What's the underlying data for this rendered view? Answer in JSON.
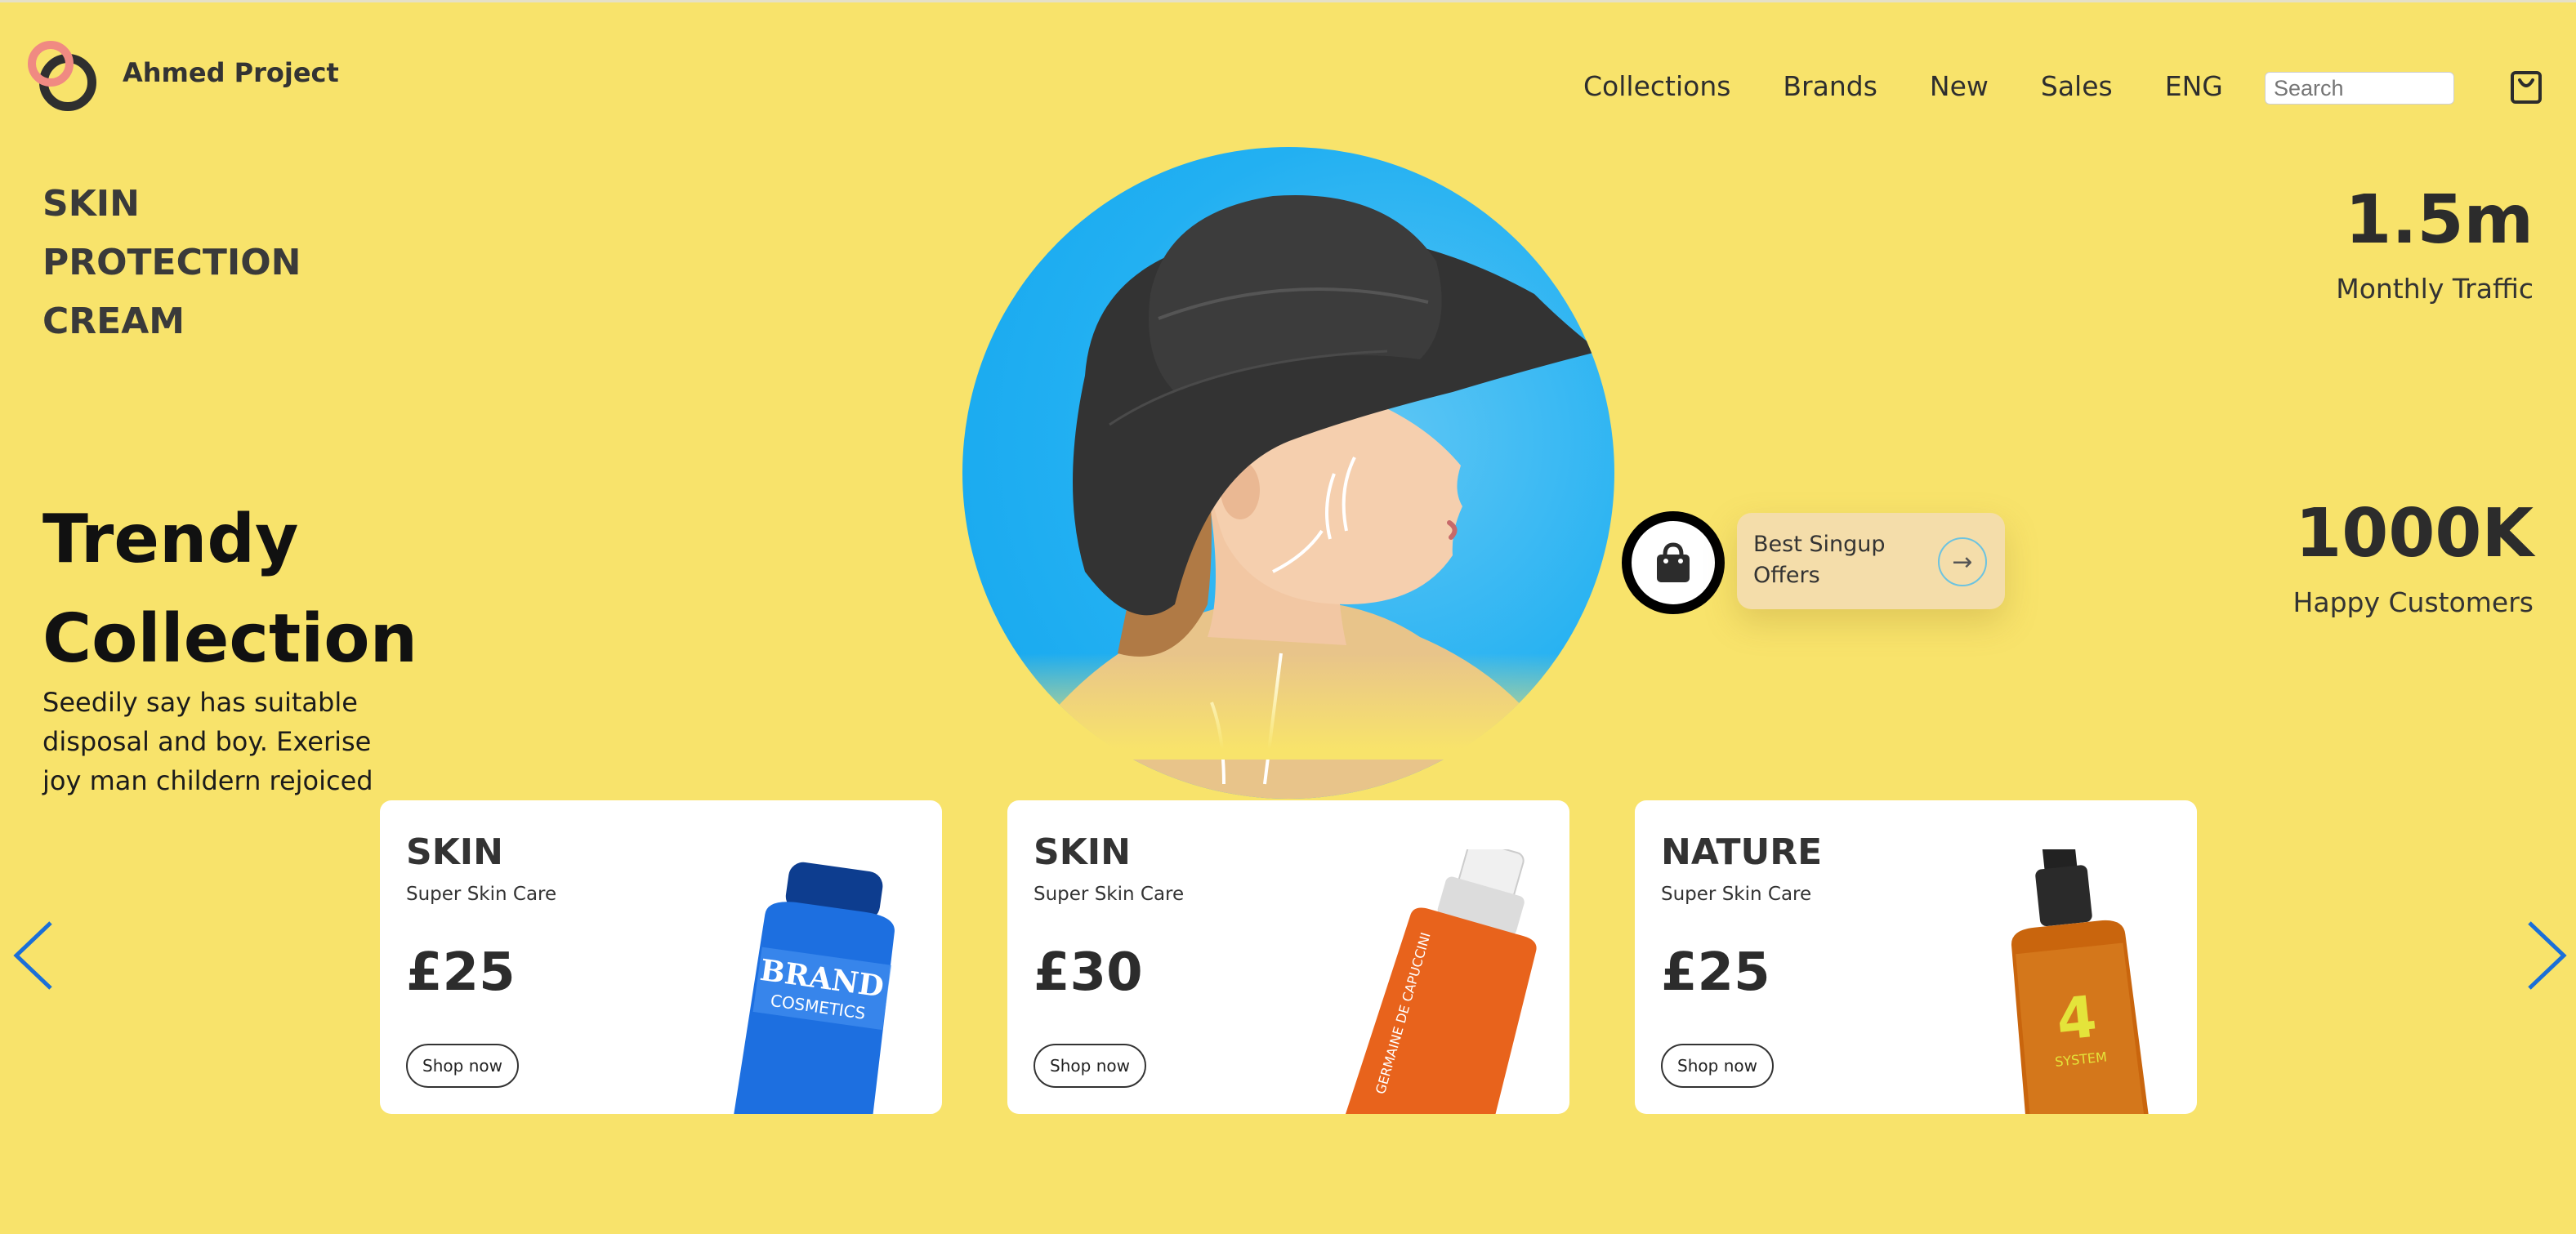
{
  "header": {
    "brand": "Ahmed Project",
    "nav": [
      "Collections",
      "Brands",
      "New",
      "Sales",
      "ENG"
    ],
    "search_placeholder": "Search"
  },
  "hero": {
    "tagline": [
      "SKIN",
      "PROTECTION",
      "CREAM"
    ],
    "title": [
      "Trendy",
      "Collection"
    ],
    "description": "Seedily say has suitable disposal and boy. Exerise joy man childern rejoiced"
  },
  "offer": {
    "text": "Best Singup Offers"
  },
  "stats": [
    {
      "value": "1.5m",
      "label": "Monthly Traffic"
    },
    {
      "value": "1000K",
      "label": "Happy Customers"
    }
  ],
  "products": [
    {
      "title": "SKIN",
      "subtitle": "Super Skin Care",
      "price": "£25",
      "button": "Shop now",
      "bottle_color": "#1d6fe0",
      "bottle_text": "BRAND COSMETICS"
    },
    {
      "title": "SKIN",
      "subtitle": "Super Skin Care",
      "price": "£30",
      "button": "Shop now",
      "bottle_color": "#e8631c",
      "bottle_text": "GERMAINE DE CAPUCCINI"
    },
    {
      "title": "NATURE",
      "subtitle": "Super Skin Care",
      "price": "£25",
      "button": "Shop now",
      "bottle_color": "#c9650d",
      "bottle_text": "SYSTEM 4"
    }
  ],
  "icons": {
    "cart": "shopping-bag-icon",
    "prev": "chevron-left-icon",
    "next": "chevron-right-icon",
    "offer_arrow": "arrow-right-icon"
  },
  "colors": {
    "background": "#f8e36b",
    "hero_circle": "#22b0f2",
    "offer_card": "#f4ddaa",
    "arrow_blue": "#1a6fd8"
  }
}
